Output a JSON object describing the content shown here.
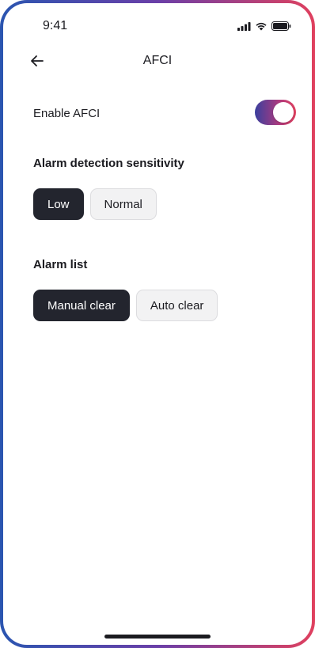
{
  "status_bar": {
    "time": "9:41",
    "icons": [
      "signal-icon",
      "wifi-icon",
      "battery-icon"
    ]
  },
  "header": {
    "back_icon": "arrow-left-icon",
    "title": "AFCI"
  },
  "afci_toggle": {
    "label": "Enable AFCI",
    "enabled": true
  },
  "sensitivity": {
    "title": "Alarm detection sensitivity",
    "options": [
      {
        "label": "Low",
        "selected": true
      },
      {
        "label": "Normal",
        "selected": false
      }
    ]
  },
  "alarm_list": {
    "title": "Alarm list",
    "options": [
      {
        "label": "Manual clear",
        "selected": true
      },
      {
        "label": "Auto clear",
        "selected": false
      }
    ]
  },
  "colors": {
    "accent_start": "#2a55b0",
    "accent_end": "#e0405e",
    "chip_selected": "#23252e",
    "chip_unselected": "#f2f2f3"
  }
}
